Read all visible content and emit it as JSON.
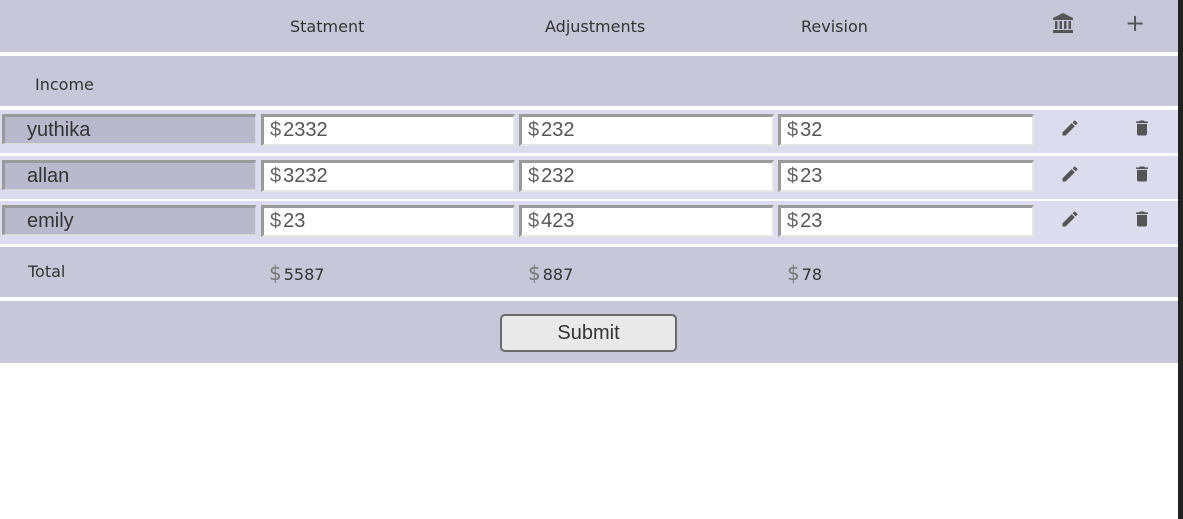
{
  "header": {
    "col_statement": "Statment",
    "col_adjustments": "Adjustments",
    "col_revision": "Revision",
    "bank_icon": "bank-icon",
    "add_icon": "+"
  },
  "income": {
    "label": "Income"
  },
  "currency_symbol": "$",
  "rows": [
    {
      "name": "yuthika",
      "statement": "2332",
      "adjustments": "232",
      "revision": "32"
    },
    {
      "name": "allan",
      "statement": "3232",
      "adjustments": "232",
      "revision": "23"
    },
    {
      "name": "emily",
      "statement": "23",
      "adjustments": "423",
      "revision": "23"
    }
  ],
  "totals": {
    "label": "Total",
    "statement": "5587",
    "adjustments": "887",
    "revision": "78"
  },
  "submit_label": "Submit",
  "colors": {
    "band": "#c8c7d9",
    "row": "#dcdcee",
    "name_field": "#b9b9cd",
    "icon": "#555555"
  }
}
